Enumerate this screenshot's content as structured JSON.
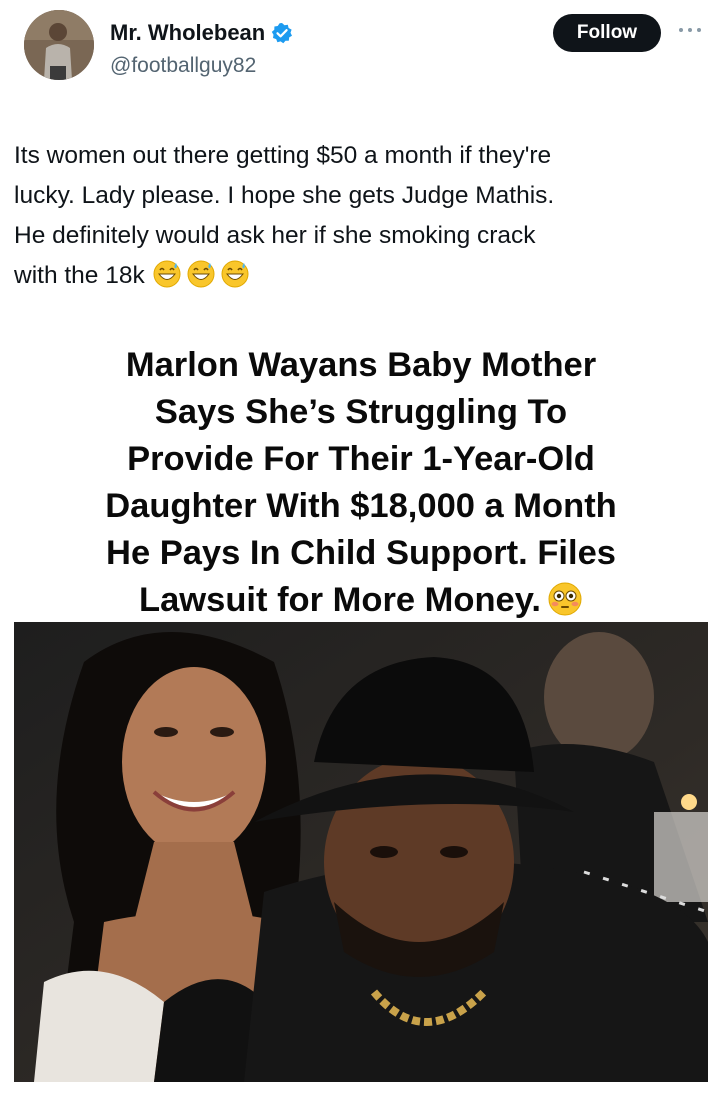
{
  "author": {
    "display_name": "Mr. Wholebean",
    "handle": "@footballguy82",
    "verified": true
  },
  "actions": {
    "follow_label": "Follow",
    "more_icon": "more-dots-icon"
  },
  "tweet": {
    "lines": [
      "Its women out there getting $50 a month if they're",
      "lucky. Lady please. I hope she gets Judge Mathis.",
      "He definitely would ask her if she smoking crack",
      "with the 18k"
    ],
    "emojis": [
      "grinning-sweat-emoji",
      "grinning-sweat-emoji",
      "grinning-sweat-emoji"
    ]
  },
  "card": {
    "headline_lines": [
      "Marlon Wayans Baby Mother",
      "Says She’s Struggling To",
      "Provide For Their 1-Year-Old",
      "Daughter With $18,000 a Month",
      "He Pays In Child Support. Files",
      "Lawsuit for More Money."
    ],
    "headline_emoji": "flushed-face-emoji"
  },
  "colors": {
    "text": "#0f1419",
    "secondary": "#536471",
    "verified": "#1d9bf0",
    "follow_bg": "#0f1419"
  }
}
